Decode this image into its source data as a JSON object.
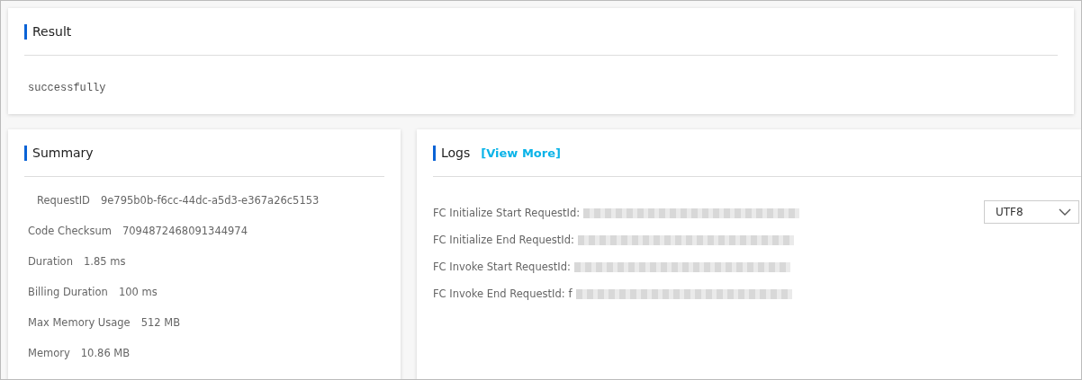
{
  "result": {
    "title": "Result",
    "text": "successfully"
  },
  "summary": {
    "title": "Summary",
    "rows": [
      {
        "label": "RequestID",
        "value": "9e795b0b-f6cc-44dc-a5d3-e367a26c5153"
      },
      {
        "label": "Code Checksum",
        "value": "7094872468091344974"
      },
      {
        "label": "Duration",
        "value": "1.85 ms"
      },
      {
        "label": "Billing Duration",
        "value": "100 ms"
      },
      {
        "label": "Max Memory Usage",
        "value": "512 MB"
      },
      {
        "label": "Memory",
        "value": "10.86 MB"
      }
    ]
  },
  "logs": {
    "title": "Logs",
    "link": "[View More]",
    "encoding": "UTF8",
    "lines": [
      {
        "label": "FC Initialize Start RequestId:"
      },
      {
        "label": "FC Initialize End RequestId:"
      },
      {
        "label": "FC Invoke Start RequestId:"
      },
      {
        "label": "FC Invoke End RequestId:",
        "value": "f"
      }
    ]
  }
}
